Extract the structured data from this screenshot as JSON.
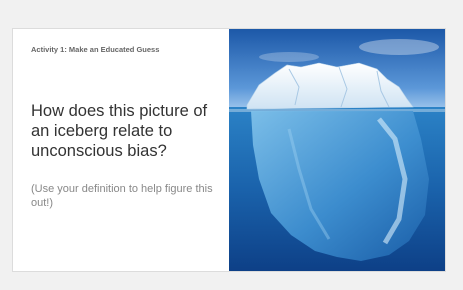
{
  "slide": {
    "activity_label": "Activity 1: Make an Educated Guess",
    "question": "How does this picture of an iceberg relate to unconscious bias?",
    "note": "(Use your definition to help figure this out!)"
  },
  "image": {
    "subject": "iceberg-above-and-below-waterline",
    "colors": {
      "sky_top": "#1c58a8",
      "sky_bottom": "#a9cdf0",
      "water_top": "#2b82c6",
      "water_bottom": "#0d3f86",
      "ice": "#eaf4fb"
    }
  }
}
